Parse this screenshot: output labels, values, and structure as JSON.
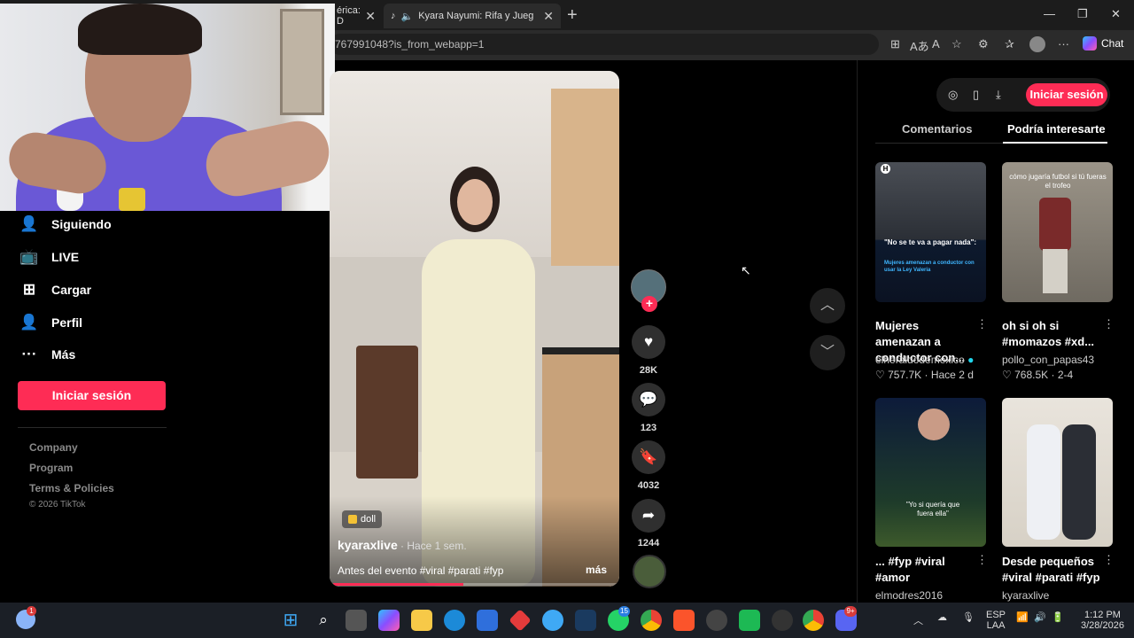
{
  "browser": {
    "tabs": [
      {
        "label": "érica: D"
      },
      {
        "label": "Kyara Nayumi: Rifa y Juegos P"
      }
    ],
    "url": "767991048?is_from_webapp=1",
    "chat_label": "Chat",
    "window_controls": [
      "—",
      "❐",
      "✕"
    ]
  },
  "nav": {
    "items": [
      {
        "label": "Siguiendo",
        "icon": "following-icon"
      },
      {
        "label": "LIVE",
        "icon": "live-icon"
      },
      {
        "label": "Cargar",
        "icon": "upload-icon"
      },
      {
        "label": "Perfil",
        "icon": "profile-icon"
      },
      {
        "label": "Más",
        "icon": "more-icon"
      }
    ],
    "login_label": "Iniciar sesión",
    "footer_links": [
      "Company",
      "Program",
      "Terms & Policies"
    ],
    "copyright": "© 2026 TikTok"
  },
  "video": {
    "tag": "doll",
    "author": "kyaraxlive",
    "time": "· Hace 1 sem.",
    "caption": "Antes del evento #viral #parati #fyp",
    "more": "más",
    "progress": 0.46
  },
  "actions": {
    "likes": "28K",
    "comments": "123",
    "saves": "4032",
    "shares": "1244"
  },
  "panel": {
    "login_label": "Iniciar sesión",
    "tabs": [
      "Comentarios",
      "Podría interesarte"
    ],
    "cards": [
      {
        "title": "Mujeres amenazan a conductor con...",
        "author": "elheraldodemexico",
        "likes": "757.7K",
        "date": "Hace 2 d",
        "verified": true,
        "thumb_text": [
          "\"No se te va a pagar nada\":",
          "Mujeres amenazan a conductor con usar la Ley Valeria"
        ]
      },
      {
        "title": "oh si oh si #momazos #xd...",
        "author": "pollo_con_papas43",
        "likes": "768.5K",
        "date": "2-4",
        "verified": false,
        "thumb_text": [
          "cómo jugaría futbol si tú fueras el trofeo"
        ]
      },
      {
        "title": "... #fyp #viral #amor",
        "author": "elmodres2016",
        "likes": "",
        "date": "",
        "verified": false,
        "thumb_text": [
          "\"Yo si quería que fuera ella\""
        ]
      },
      {
        "title": "Desde pequeños #viral #parati #fyp",
        "author": "kyaraxlive",
        "likes": "",
        "date": "",
        "verified": false,
        "thumb_text": []
      }
    ]
  },
  "taskbar": {
    "lang": "ESP",
    "lang2": "LAA",
    "time": "1:12 PM",
    "date": "3/28/2026",
    "badges": {
      "whatsapp": "15",
      "discord": "9+",
      "weather": "1"
    }
  },
  "colors": {
    "accent": "#fe2c55",
    "background": "#000000"
  }
}
